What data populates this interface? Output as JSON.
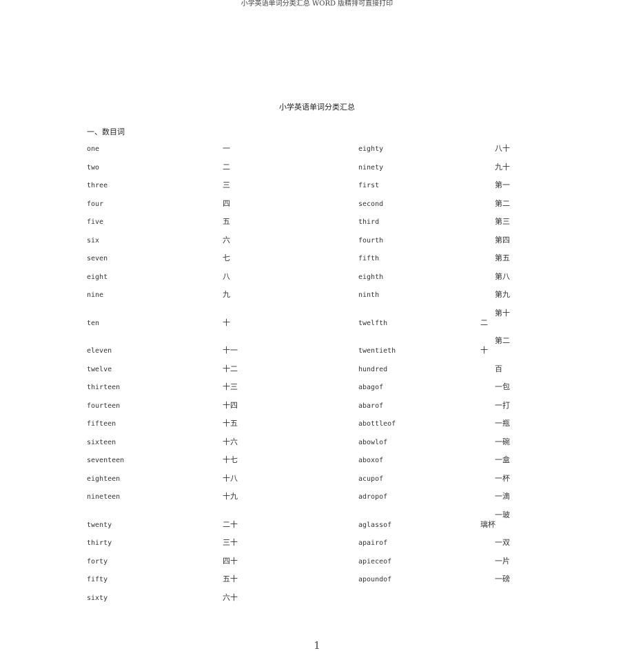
{
  "header": "小学英语单词分类汇总 WORD 版精排可直接打印",
  "title": "小学英语单词分类汇总",
  "section": "一、数目词",
  "left_column": [
    {
      "en": "one",
      "zh": "一"
    },
    {
      "en": "two",
      "zh": "二"
    },
    {
      "en": "three",
      "zh": "三"
    },
    {
      "en": "four",
      "zh": "四"
    },
    {
      "en": "five",
      "zh": "五"
    },
    {
      "en": "six",
      "zh": "六"
    },
    {
      "en": "seven",
      "zh": "七"
    },
    {
      "en": "eight",
      "zh": "八"
    },
    {
      "en": "nine",
      "zh": "九"
    },
    {
      "en": "ten",
      "zh": "十"
    },
    {
      "en": "eleven",
      "zh": "十一"
    },
    {
      "en": "twelve",
      "zh": "十二"
    },
    {
      "en": "thirteen",
      "zh": "十三"
    },
    {
      "en": "fourteen",
      "zh": "十四"
    },
    {
      "en": "fifteen",
      "zh": "十五"
    },
    {
      "en": "sixteen",
      "zh": "十六"
    },
    {
      "en": "seventeen",
      "zh": "十七"
    },
    {
      "en": "eighteen",
      "zh": "十八"
    },
    {
      "en": "nineteen",
      "zh": "十九"
    },
    {
      "en": "twenty",
      "zh": "二十"
    },
    {
      "en": "thirty",
      "zh": "三十"
    },
    {
      "en": "forty",
      "zh": "四十"
    },
    {
      "en": "fifty",
      "zh": "五十"
    },
    {
      "en": "sixty",
      "zh": "六十"
    }
  ],
  "right_column": [
    {
      "en": "eighty",
      "zh": "八十"
    },
    {
      "en": "ninety",
      "zh": "九十"
    },
    {
      "en": "first",
      "zh": "第一"
    },
    {
      "en": "second",
      "zh": "第二"
    },
    {
      "en": "third",
      "zh": "第三"
    },
    {
      "en": "fourth",
      "zh": "第四"
    },
    {
      "en": "fifth",
      "zh": "第五"
    },
    {
      "en": "eighth",
      "zh": "第八"
    },
    {
      "en": "ninth",
      "zh": "第九"
    },
    {
      "en": "twelfth",
      "zh": "第十",
      "zh_wrap": "二"
    },
    {
      "en": "twentieth",
      "zh": "第二",
      "zh_wrap": "十"
    },
    {
      "en": "hundred",
      "zh": "百"
    },
    {
      "en": "abagof",
      "zh": "一包"
    },
    {
      "en": "abarof",
      "zh": "一打"
    },
    {
      "en": "abottleof",
      "zh": "一瓶"
    },
    {
      "en": "abowlof",
      "zh": "一碗"
    },
    {
      "en": "aboxof",
      "zh": "一盒"
    },
    {
      "en": "acupof",
      "zh": "一杯"
    },
    {
      "en": "adropof",
      "zh": "一滴"
    },
    {
      "en": "aglassof",
      "zh": "一玻",
      "zh_wrap": "璃杯"
    },
    {
      "en": "apairof",
      "zh": "一双"
    },
    {
      "en": "apieceof",
      "zh": "一片"
    },
    {
      "en": "apoundof",
      "zh": "一磅"
    }
  ],
  "page_number": "1"
}
